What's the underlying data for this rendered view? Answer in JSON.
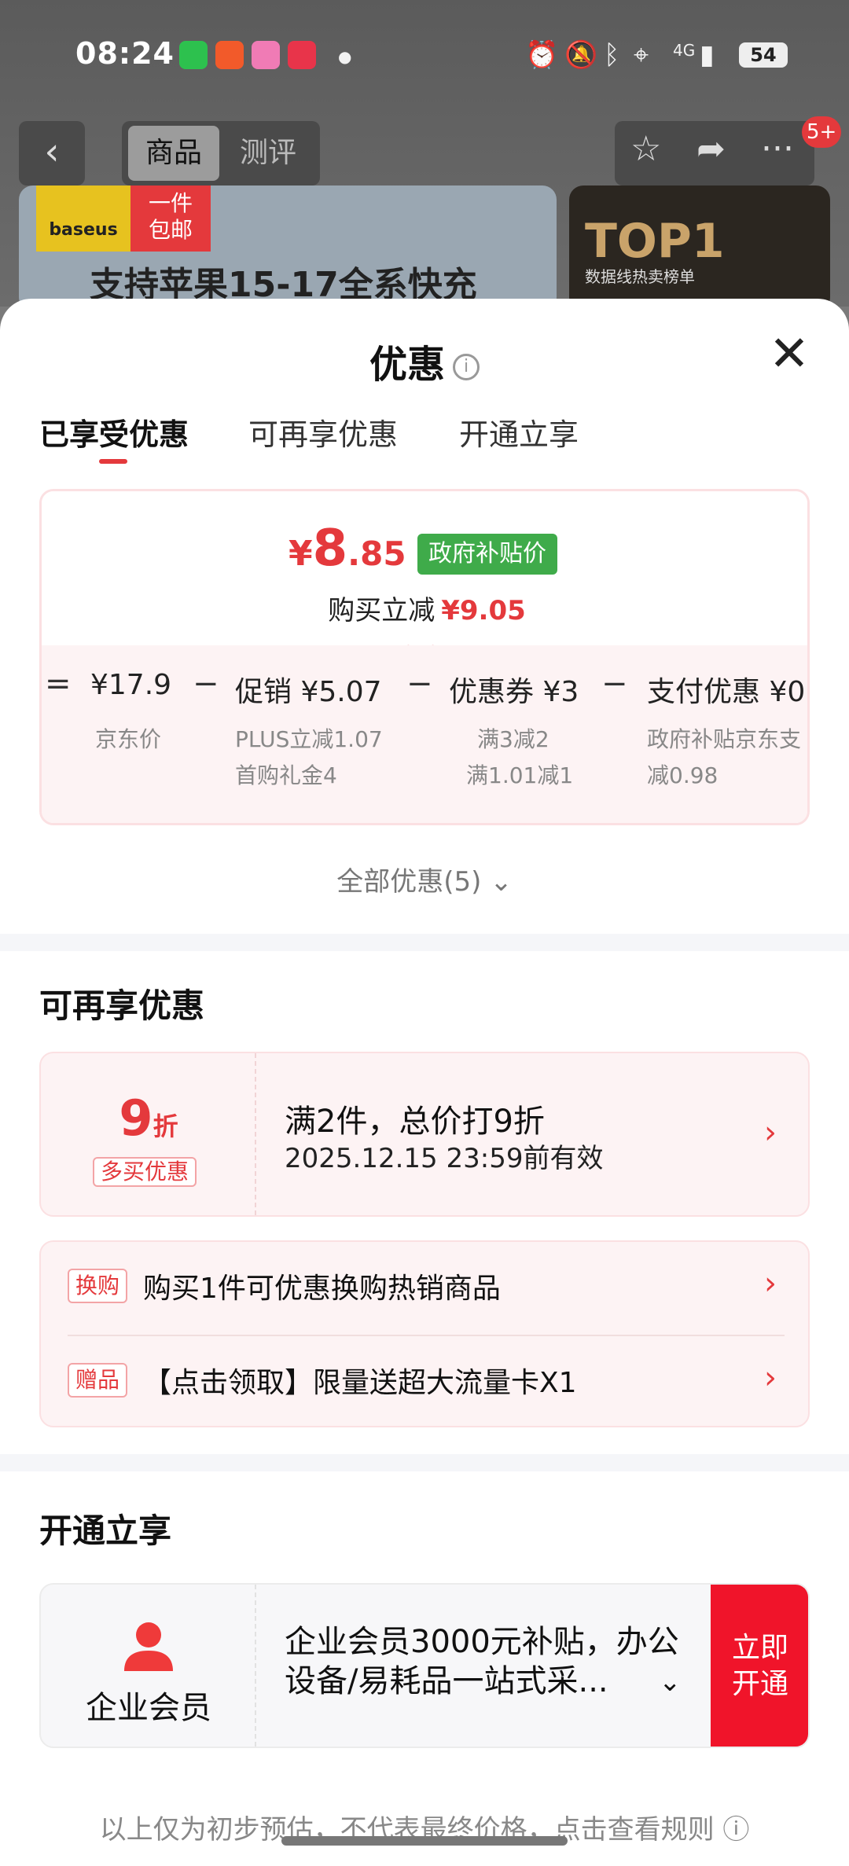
{
  "status_bar": {
    "time": "08:24",
    "battery": "54",
    "network": "4G"
  },
  "nav": {
    "back": "‹",
    "tab_product": "商品",
    "tab_review": "测评",
    "badge": "5+"
  },
  "banner": {
    "brand": "baseus",
    "tag": "一件\n包邮",
    "text": "支持苹果15-17全系快充",
    "top_text": "TOP1",
    "top_sub": "数据线热卖榜单"
  },
  "sheet": {
    "title": "优惠",
    "tabs": [
      "已享受优惠",
      "可再享优惠",
      "开通立享"
    ],
    "price": {
      "currency": "¥",
      "main": "8",
      "decimal": ".85",
      "tag": "政府补贴价"
    },
    "reduce": {
      "label": "购买立减",
      "value": "¥9.05"
    },
    "breakdown": [
      {
        "op": "=",
        "amount": "¥17.9",
        "sub1": "京东价",
        "sub2": ""
      },
      {
        "op": "−",
        "amount": "促销 ¥5.07",
        "sub1": "PLUS立减1.07",
        "sub2": "首购礼金4"
      },
      {
        "op": "−",
        "amount": "优惠券 ¥3",
        "sub1": "满3减2",
        "sub2": "满1.01减1"
      },
      {
        "op": "−",
        "amount": "支付优惠 ¥0.",
        "sub1": "政府补贴京东支",
        "sub2": "减0.98"
      }
    ],
    "all_promos": "全部优惠(5)",
    "more": {
      "section_title": "可再享优惠",
      "discount": {
        "num": "9",
        "unit": "折",
        "tag": "多买优惠",
        "line1": "满2件，总价打9折",
        "line2": "2025.12.15 23:59前有效"
      },
      "gifts": [
        {
          "tag": "换购",
          "text": "购买1件可优惠换购热销商品"
        },
        {
          "tag": "赠品",
          "text": "【点击领取】限量送超大流量卡X1"
        }
      ]
    },
    "open": {
      "section_title": "开通立享",
      "member_label": "企业会员",
      "member_text": "企业会员3000元补贴，办公设备/易耗品一站式采...",
      "button": "立即\n开通"
    },
    "footnote": "以上仅为初步预估，不代表最终价格，点击查看规则"
  },
  "colors": {
    "accent": "#e4393c",
    "gov_green": "#3fab4a",
    "cta": "#f0142a"
  }
}
